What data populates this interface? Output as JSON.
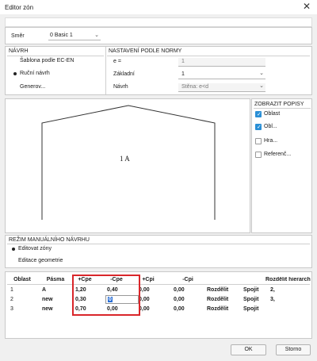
{
  "window": {
    "title": "Editor zón",
    "close_icon": "close-icon"
  },
  "smer": {
    "label": "Směr",
    "value": "0 Basic 1"
  },
  "navrh": {
    "header": "NÁVRH",
    "options": [
      {
        "label": "Šablona podle EC-EN",
        "selected": false
      },
      {
        "label": "Ruční návrh",
        "selected": true
      },
      {
        "label": "Generov...",
        "selected": false
      }
    ]
  },
  "norma": {
    "header": "NASTAVENÍ PODLE NORMY",
    "e_label": "e =",
    "e_value": "1",
    "zakladni_label": "Základní",
    "zakladni_value": "1",
    "navrh_label": "Návrh",
    "navrh_value": "Stěna: e<d"
  },
  "preview": {
    "zone_label": "1 A"
  },
  "popisy": {
    "header": "ZOBRAZIT POPISY",
    "items": [
      {
        "label": "Oblast",
        "checked": true
      },
      {
        "label": "Obl...",
        "checked": true
      },
      {
        "label": "Hra...",
        "checked": false
      },
      {
        "label": "Referenč...",
        "checked": false
      }
    ]
  },
  "rezim": {
    "header": "REŽIM MANUÁLNÍHO NÁVRHU",
    "options": [
      {
        "label": "Editovat zóny",
        "selected": true
      },
      {
        "label": "Editace geometrie",
        "selected": false
      }
    ]
  },
  "table": {
    "headers": [
      "Oblast",
      "Pásma",
      "+Cpe",
      "-Cpe",
      "+Cpi",
      "-Cpi",
      "",
      "",
      "Rozdělit hierarch"
    ],
    "rows": [
      {
        "oblast": "1",
        "pasma": "A",
        "pcpe": "1,20",
        "mcpe": "0,40",
        "pcpi": "0,00",
        "mcpi": "0,00",
        "btn1": "Rozdělit",
        "btn2": "Spojit",
        "hier": "2,"
      },
      {
        "oblast": "2",
        "pasma": "new",
        "pcpe": "0,30",
        "mcpe": "0",
        "pcpi": "0,00",
        "mcpi": "0,00",
        "btn1": "Rozdělit",
        "btn2": "Spojit",
        "hier": "3,"
      },
      {
        "oblast": "3",
        "pasma": "new",
        "pcpe": "0,70",
        "mcpe": "0,00",
        "pcpi": "0,00",
        "mcpi": "0,00",
        "btn1": "Rozdělit",
        "btn2": "Spojit",
        "hier": ""
      }
    ]
  },
  "footer": {
    "ok": "OK",
    "cancel": "Storno"
  },
  "colors": {
    "highlight_box": "#d9262a",
    "checkbox": "#2a8fd6",
    "background": "#f0f0f0"
  }
}
